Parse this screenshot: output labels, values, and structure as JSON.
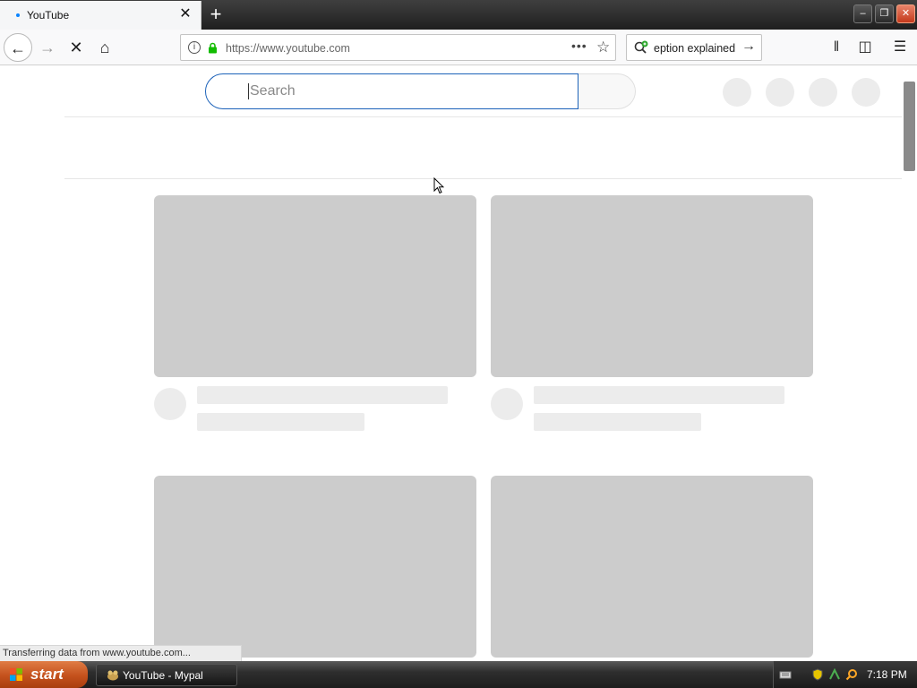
{
  "browser": {
    "tab": {
      "title": "YouTube",
      "close_glyph": "✕"
    },
    "new_tab_glyph": "+",
    "window_controls": {
      "minimize": "–",
      "restore": "❐",
      "close": "✕"
    },
    "nav": {
      "back_glyph": "←",
      "forward_glyph": "→",
      "stop_glyph": "✕",
      "home_glyph": "⌂"
    },
    "url": "https://www.youtube.com",
    "page_actions": {
      "more_glyph": "•••",
      "bookmark_glyph": "☆"
    },
    "search_box": {
      "value": "eption explained",
      "go_glyph": "→"
    },
    "toolbar": {
      "library_glyph": "𝍪",
      "sidebar_glyph": "◫",
      "menu_glyph": "☰"
    },
    "status_text": "Transferring data from www.youtube.com..."
  },
  "youtube": {
    "search_placeholder": "Search",
    "accent_color": "#1c62b9",
    "skeleton_color": "#cccccc"
  },
  "taskbar": {
    "start_label": "start",
    "task_label": "YouTube - Mypal",
    "clock": "7:18 PM"
  }
}
